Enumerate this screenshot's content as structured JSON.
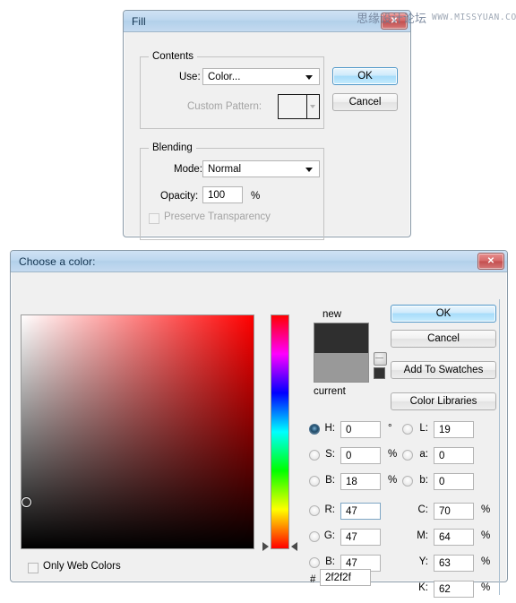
{
  "watermark": {
    "forum": "思缘设计论坛",
    "site": "WWW.MISSYUAN.COM"
  },
  "fill_dialog": {
    "title": "Fill",
    "close_label": "✕",
    "contents_group": {
      "legend": "Contents",
      "use_label": "Use:",
      "use_value": "Color...",
      "custom_pattern_label": "Custom Pattern:"
    },
    "blending_group": {
      "legend": "Blending",
      "mode_label": "Mode:",
      "mode_value": "Normal",
      "opacity_label": "Opacity:",
      "opacity_value": "100",
      "percent_label": "%",
      "preserve_transparency_label": "Preserve Transparency"
    },
    "ok_label": "OK",
    "cancel_label": "Cancel"
  },
  "color_dialog": {
    "title": "Choose a color:",
    "close_label": "✕",
    "new_label": "new",
    "current_label": "current",
    "new_color": "#2f2f2f",
    "current_color": "#999999",
    "mini_swatch_color": "#333333",
    "buttons": {
      "ok": "OK",
      "cancel": "Cancel",
      "add_to_swatches": "Add To Swatches",
      "color_libraries": "Color Libraries"
    },
    "only_web_colors_label": "Only Web Colors",
    "hex_symbol": "#",
    "hex_value": "2f2f2f",
    "hsb": [
      {
        "key": "H",
        "label": "H:",
        "value": "0",
        "unit": "°",
        "selected": true
      },
      {
        "key": "S",
        "label": "S:",
        "value": "0",
        "unit": "%",
        "selected": false
      },
      {
        "key": "B",
        "label": "B:",
        "value": "18",
        "unit": "%",
        "selected": false
      }
    ],
    "rgb": [
      {
        "key": "R",
        "label": "R:",
        "value": "47",
        "unit": "",
        "selected": false
      },
      {
        "key": "G",
        "label": "G:",
        "value": "47",
        "unit": "",
        "selected": false
      },
      {
        "key": "B",
        "label": "B:",
        "value": "47",
        "unit": "",
        "selected": false
      }
    ],
    "lab": [
      {
        "key": "L",
        "label": "L:",
        "value": "19",
        "unit": "",
        "selected": false
      },
      {
        "key": "a",
        "label": "a:",
        "value": "0",
        "unit": "",
        "selected": false
      },
      {
        "key": "b",
        "label": "b:",
        "value": "0",
        "unit": "",
        "selected": false
      }
    ],
    "cmyk": [
      {
        "key": "C",
        "label": "C:",
        "value": "70",
        "unit": "%"
      },
      {
        "key": "M",
        "label": "M:",
        "value": "64",
        "unit": "%"
      },
      {
        "key": "Y",
        "label": "Y:",
        "value": "63",
        "unit": "%"
      },
      {
        "key": "K",
        "label": "K:",
        "value": "62",
        "unit": "%"
      }
    ],
    "field": {
      "marker_x_pct": 2,
      "marker_y_pct": 80
    },
    "hue": {
      "marker_pct": 99
    }
  }
}
